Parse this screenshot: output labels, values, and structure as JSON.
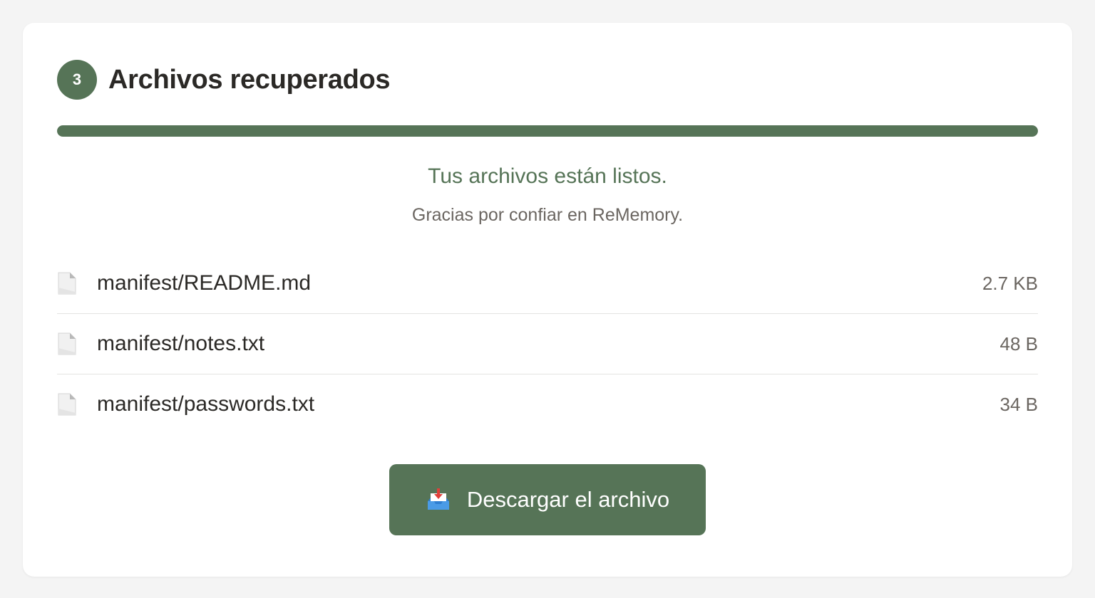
{
  "step": {
    "number": "3",
    "title": "Archivos recuperados"
  },
  "progress": {
    "value": 1.0
  },
  "status_message": "Tus archivos están listos.",
  "thanks_message": "Gracias por confiar en ReMemory.",
  "files": [
    {
      "name": "manifest/README.md",
      "size": "2.7 KB",
      "icon": "file-icon"
    },
    {
      "name": "manifest/notes.txt",
      "size": "48 B",
      "icon": "file-icon"
    },
    {
      "name": "manifest/passwords.txt",
      "size": "34 B",
      "icon": "file-icon"
    }
  ],
  "download_button": {
    "label": "Descargar el archivo",
    "icon": "inbox-download-icon"
  },
  "colors": {
    "accent": "#567457",
    "background": "#f4f4f4",
    "card": "#ffffff",
    "text_primary": "#2b2926",
    "text_secondary": "#6b6661"
  }
}
